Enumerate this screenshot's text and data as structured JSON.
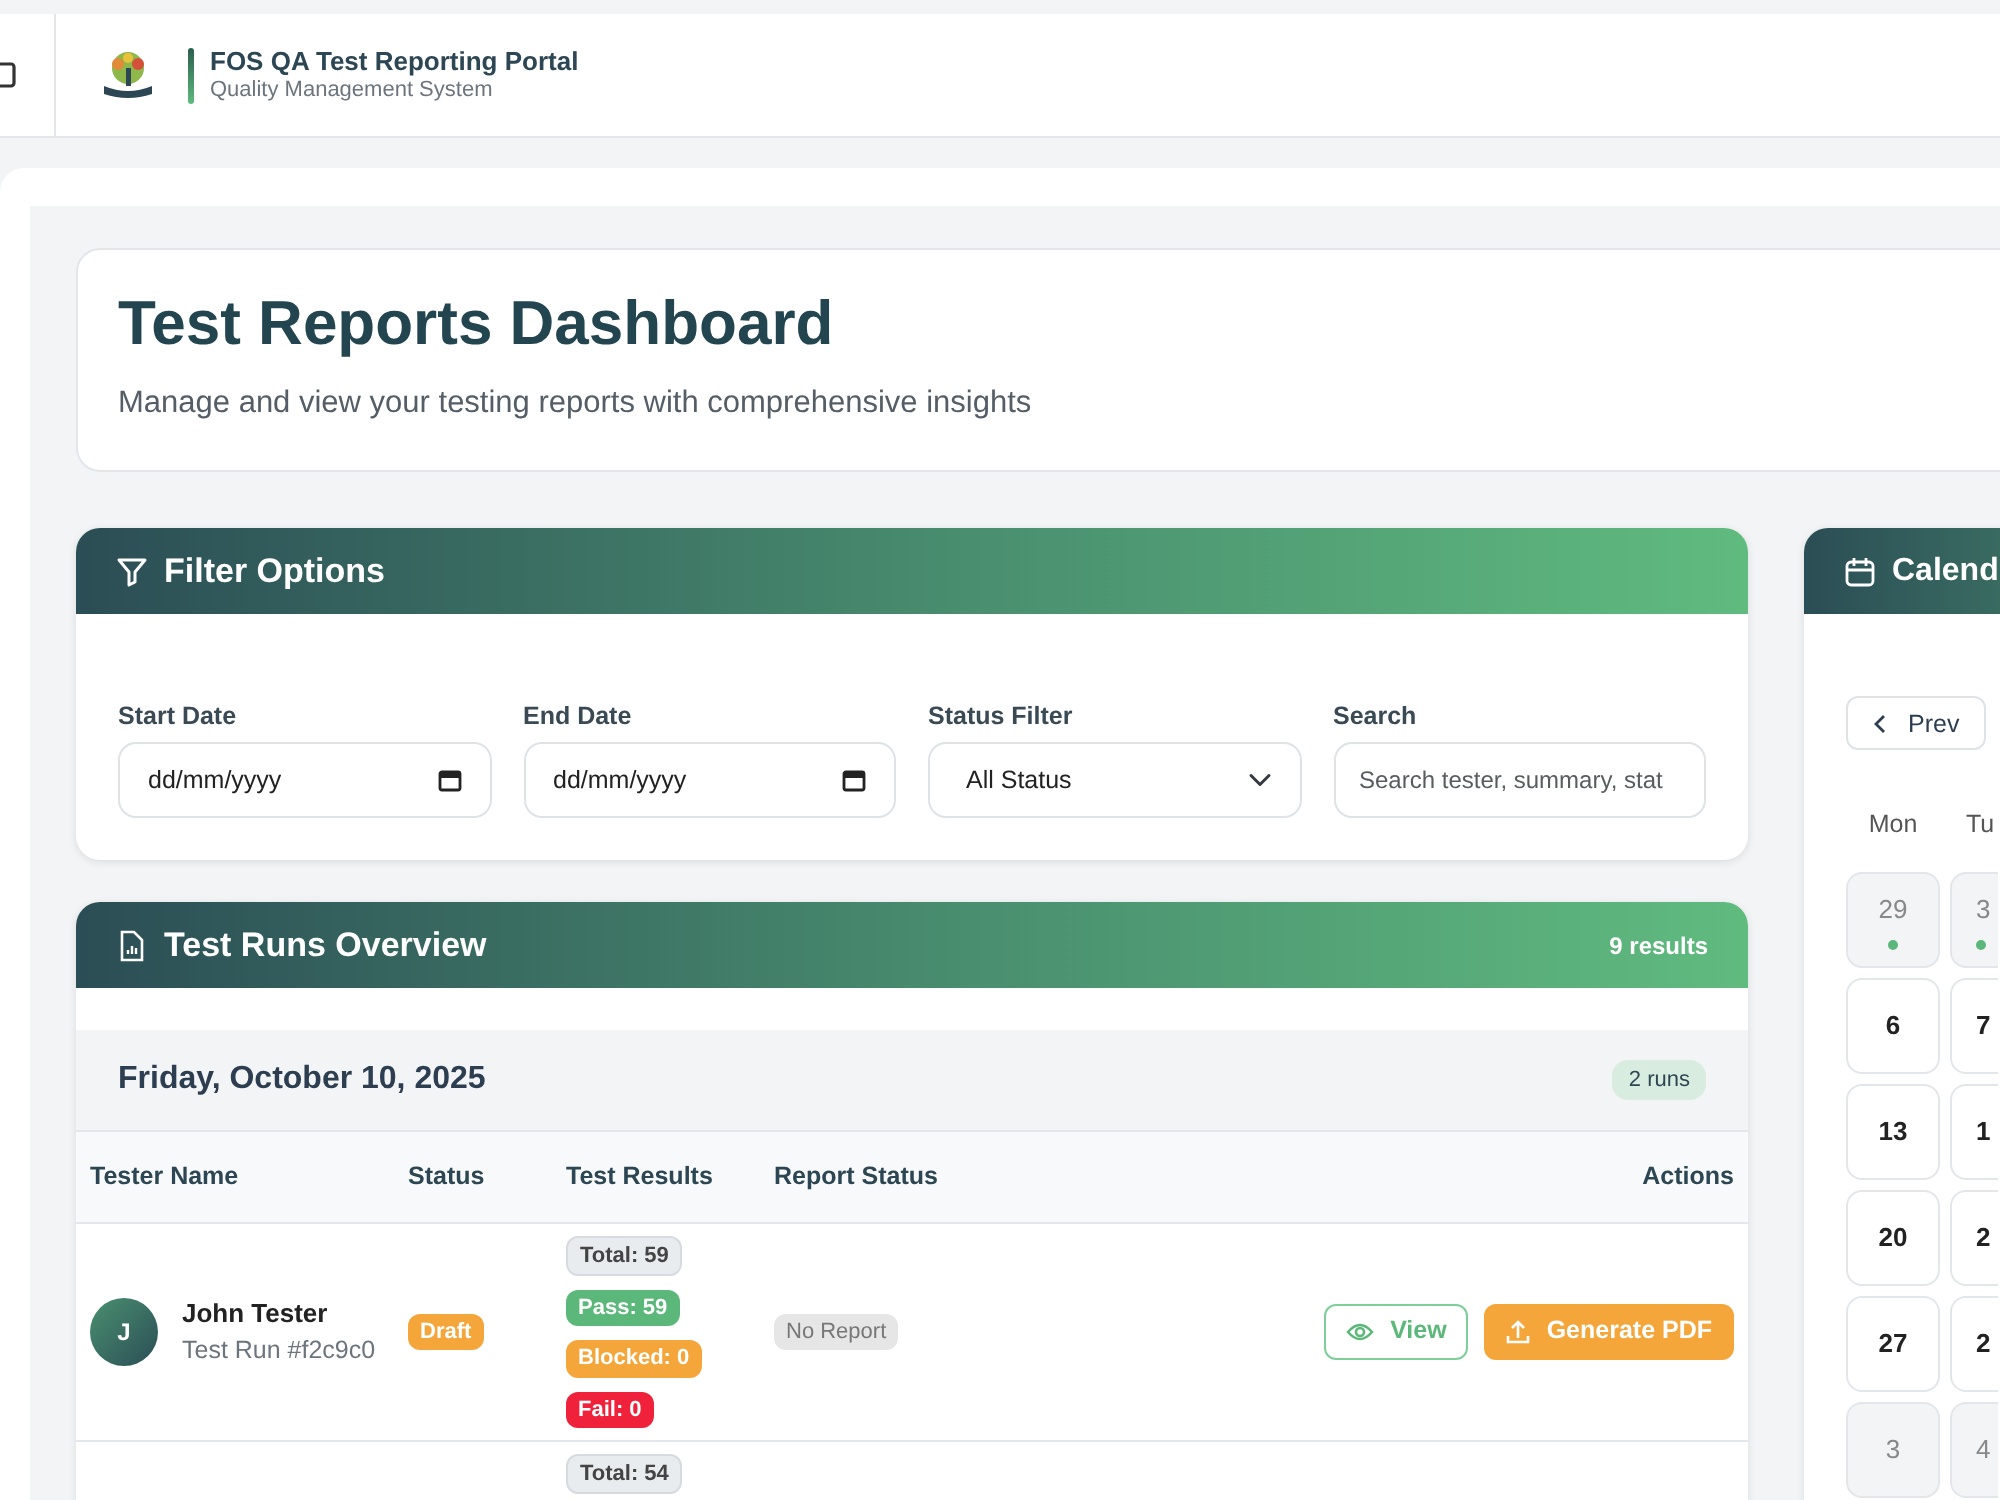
{
  "header": {
    "title": "FOS QA Test Reporting Portal",
    "subtitle": "Quality Management System"
  },
  "page": {
    "title": "Test Reports Dashboard",
    "subtitle": "Manage and view your testing reports with comprehensive insights"
  },
  "filters": {
    "title": "Filter Options",
    "fields": [
      {
        "kind": "date",
        "label": "Start Date",
        "placeholder": "dd/mm/yyyy"
      },
      {
        "kind": "date",
        "label": "End Date",
        "placeholder": "dd/mm/yyyy"
      },
      {
        "kind": "select",
        "label": "Status Filter",
        "value": "All Status"
      },
      {
        "kind": "search",
        "label": "Search",
        "placeholder": "Search tester, summary, stat"
      }
    ]
  },
  "runs": {
    "title": "Test Runs Overview",
    "count": "9 results",
    "groups": [
      {
        "date": "Friday, October 10, 2025",
        "count": "2 runs",
        "columns": [
          "Tester Name",
          "Status",
          "Test Results",
          "Report Status",
          "Actions"
        ],
        "rows": [
          {
            "avatar": "J",
            "name": "John Tester",
            "run": "Test Run #f2c9c0",
            "status": "Draft",
            "results": [
              {
                "kind": "total",
                "label": "Total: 59"
              },
              {
                "kind": "pass",
                "label": "Pass: 59"
              },
              {
                "kind": "blocked",
                "label": "Blocked: 0"
              },
              {
                "kind": "fail",
                "label": "Fail: 0"
              }
            ],
            "report": "No Report",
            "actions": [
              {
                "kind": "view",
                "label": "View"
              },
              {
                "kind": "pdf",
                "label": "Generate PDF"
              }
            ]
          },
          {
            "results": [
              {
                "kind": "total",
                "label": "Total: 54"
              }
            ]
          }
        ]
      }
    ]
  },
  "calendar": {
    "title": "Calend",
    "prev": "Prev",
    "weekdays": [
      "Mon",
      "Tu"
    ],
    "weeks": [
      [
        {
          "day": "29",
          "outside_month": true,
          "has_runs": true
        },
        {
          "day": "3",
          "outside_month": true,
          "has_runs": true
        }
      ],
      [
        {
          "day": "6",
          "outside_month": false,
          "has_runs": false
        },
        {
          "day": "7",
          "outside_month": false,
          "has_runs": false
        }
      ],
      [
        {
          "day": "13",
          "outside_month": false,
          "has_runs": false
        },
        {
          "day": "1",
          "outside_month": false,
          "has_runs": false
        }
      ],
      [
        {
          "day": "20",
          "outside_month": false,
          "has_runs": false
        },
        {
          "day": "2",
          "outside_month": false,
          "has_runs": false
        }
      ],
      [
        {
          "day": "27",
          "outside_month": false,
          "has_runs": false
        },
        {
          "day": "2",
          "outside_month": false,
          "has_runs": false
        }
      ],
      [
        {
          "day": "3",
          "outside_month": true,
          "has_runs": false
        },
        {
          "day": "4",
          "outside_month": true,
          "has_runs": false
        }
      ]
    ]
  }
}
